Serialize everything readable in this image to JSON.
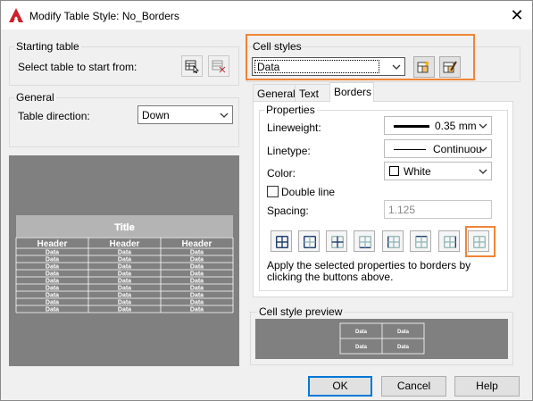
{
  "window": {
    "title": "Modify Table Style: No_Borders"
  },
  "starting_table": {
    "group_label": "Starting table",
    "select_label": "Select table to start from:"
  },
  "general": {
    "group_label": "General",
    "direction_label": "Table direction:",
    "direction_value": "Down"
  },
  "cell_styles": {
    "group_label": "Cell styles",
    "selected": "Data"
  },
  "tabs": [
    {
      "label": "General"
    },
    {
      "label": "Text"
    },
    {
      "label": "Borders"
    }
  ],
  "properties": {
    "group_label": "Properties",
    "lineweight_label": "Lineweight:",
    "lineweight_value": "0.35 mm",
    "linetype_label": "Linetype:",
    "linetype_value": "Continuou",
    "color_label": "Color:",
    "color_value": "White",
    "double_line_label": "Double line",
    "spacing_label": "Spacing:",
    "spacing_value": "1.125",
    "hint": "Apply the selected properties to borders by clicking the buttons above."
  },
  "border_buttons": [
    {
      "icon": "all-borders-icon"
    },
    {
      "icon": "outside-borders-icon"
    },
    {
      "icon": "inside-borders-icon"
    },
    {
      "icon": "bottom-border-icon"
    },
    {
      "icon": "left-border-icon"
    },
    {
      "icon": "top-border-icon"
    },
    {
      "icon": "right-border-icon"
    },
    {
      "icon": "no-border-icon"
    }
  ],
  "table_preview": {
    "title": "Title",
    "headers": [
      "Header",
      "Header",
      "Header"
    ],
    "cell": "Data",
    "rows": 9
  },
  "cell_preview": {
    "group_label": "Cell style preview",
    "cell": "Data"
  },
  "buttons": {
    "ok": "OK",
    "cancel": "Cancel",
    "help": "Help"
  },
  "colors": {
    "highlight": "#f08437",
    "preview_bg": "#808080",
    "accent": "#0078d7"
  }
}
